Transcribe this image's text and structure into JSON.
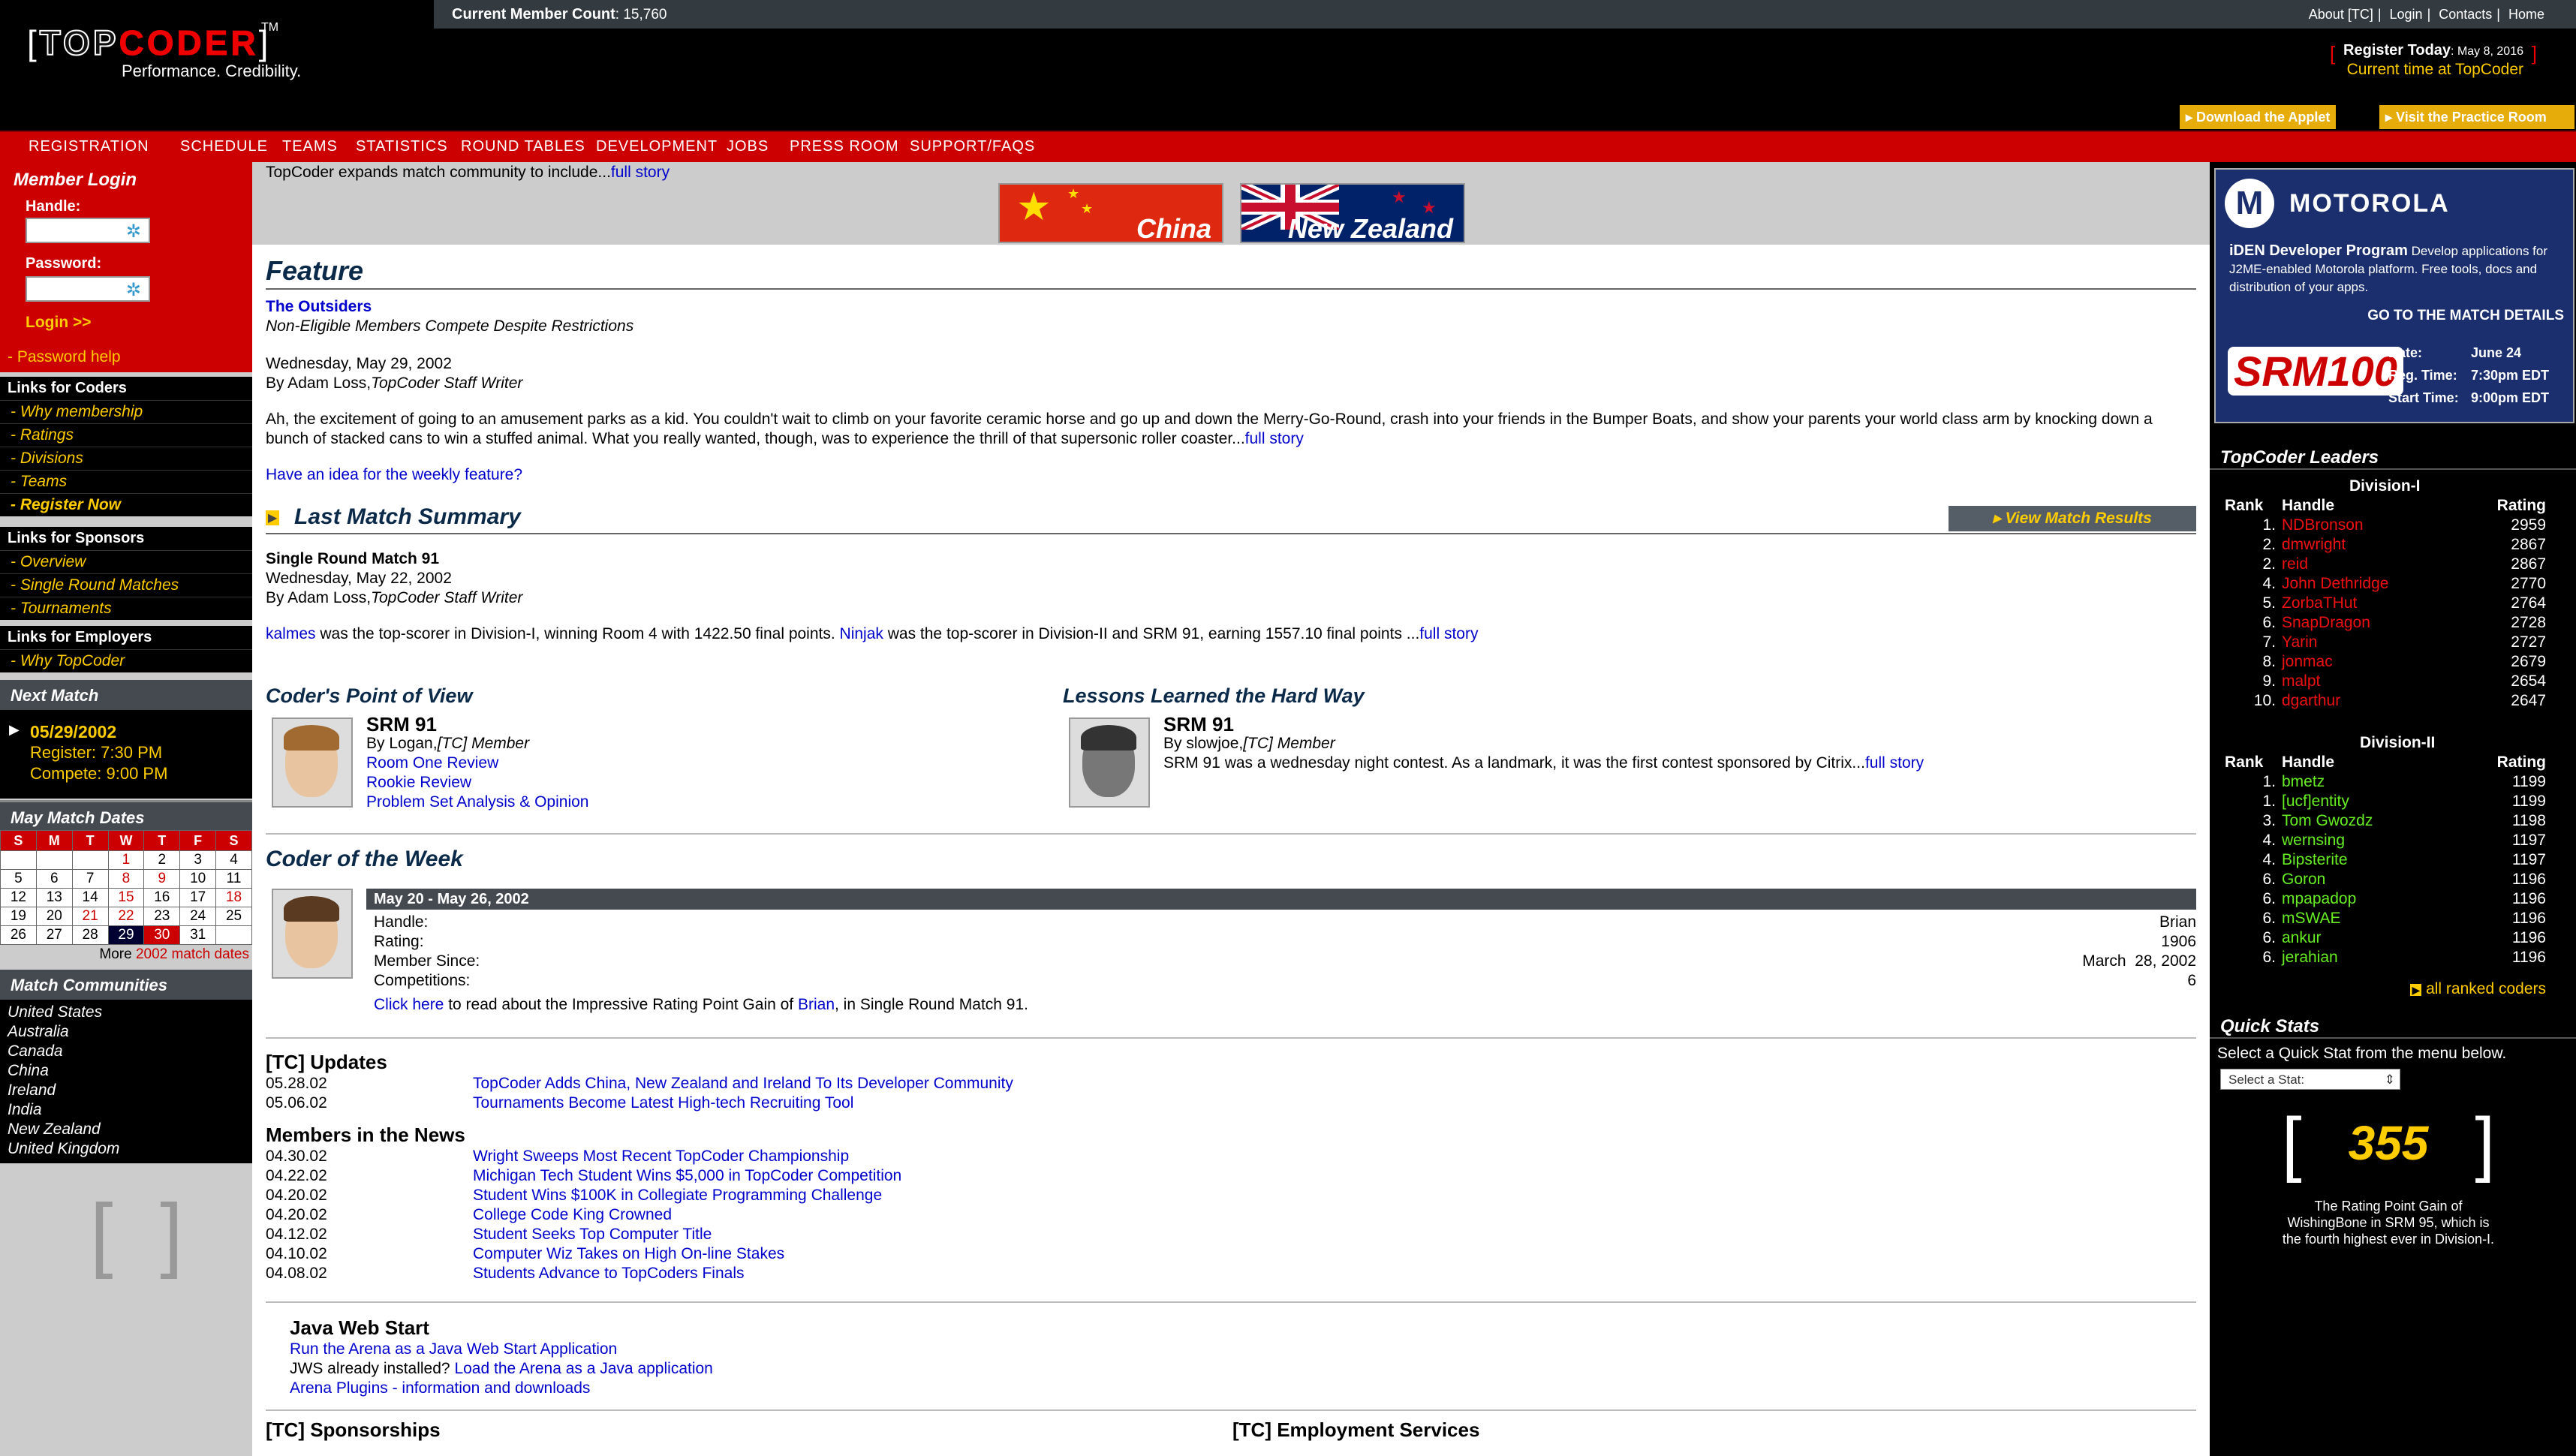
{
  "header": {
    "member_count_label": "Current Member Count",
    "member_count": ": 15,760",
    "top_links": [
      "About [TC]",
      "Login",
      "Contacts",
      "Home"
    ],
    "logo_text": "TOPCODER",
    "logo_tm": "TM",
    "tagline": "Performance. Credibility.",
    "register_label": "Register Today",
    "register_date": ": May 8, 2016",
    "current_time_label": "Current time at TopCoder",
    "applet_buttons": [
      "Download the Applet",
      "Visit the Practice Room"
    ]
  },
  "nav": [
    "REGISTRATION",
    "SCHEDULE",
    "TEAMS",
    "STATISTICS",
    "ROUND TABLES",
    "DEVELOPMENT",
    "JOBS",
    "PRESS ROOM",
    "SUPPORT/FAQS"
  ],
  "left": {
    "login_title": "Member Login",
    "handle_label": "Handle:",
    "password_label": "Password:",
    "login_button": "Login >>",
    "password_help": "- Password help",
    "coders_title": "Links for Coders",
    "coders_links": [
      "- Why membership",
      "- Ratings",
      "- Divisions",
      "- Teams",
      "- Register Now"
    ],
    "sponsors_title": "Links for Sponsors",
    "sponsors_links": [
      "- Overview",
      "- Single Round Matches",
      "- Tournaments"
    ],
    "employers_title": "Links for Employers",
    "employers_links": [
      "- Why TopCoder"
    ],
    "next_match_title": "Next Match",
    "next_match_date": "05/29/2002",
    "next_match_register": "Register:  7:30 PM",
    "next_match_compete": "Compete:  9:00 PM",
    "calendar_title": "May Match Dates",
    "calendar_days": [
      "S",
      "M",
      "T",
      "W",
      "T",
      "F",
      "S"
    ],
    "calendar_more_prefix": "More ",
    "calendar_more_link": "2002 match dates",
    "communities_title": "Match Communities",
    "communities": [
      "United States",
      "Australia",
      "Canada",
      "China",
      "Ireland",
      "India",
      "New Zealand",
      "United Kingdom"
    ],
    "bracket_glyph": "[ ]"
  },
  "center": {
    "expand_text": "TopCoder expands match community to include...",
    "expand_link": "full story",
    "flags": [
      "China",
      "New Zealand"
    ],
    "feature_title": "Feature",
    "feature_link": "The Outsiders",
    "feature_sub": "Non-Eligible Members Compete Despite Restrictions",
    "feature_date": "Wednesday, May 29, 2002",
    "feature_by": "By Adam Loss,",
    "feature_by_role": "TopCoder Staff Writer",
    "feature_body": "Ah, the excitement of going to an amusement parks as a kid. You couldn't wait to climb on your favorite ceramic horse and go up and down the Merry-Go-Round, crash into your friends in the Bumper Boats, and show your parents your world class arm by knocking down a bunch of stacked cans to win a stuffed animal. What you really wanted, though, was to experience the thrill of that supersonic roller coaster...",
    "feature_more": "full story",
    "feature_idea": "Have an idea for the weekly feature?",
    "lms_title": "Last Match Summary",
    "lms_button": "View Match Results",
    "lms_match": "Single Round Match 91",
    "lms_date": "Wednesday, May 22, 2002",
    "lms_by": "By Adam Loss,",
    "lms_by_role": "TopCoder Staff Writer",
    "lms_user1": "kalmes",
    "lms_text1": " was the top-scorer in Division-I, winning Room 4 with 1422.50 final points. ",
    "lms_user2": "Ninjak",
    "lms_text2": " was the top-scorer in Division-II and SRM 91, earning 1557.10 final points ...",
    "lms_more": "full story",
    "pov_title": "Coder's Point of View",
    "pov_srm": "SRM 91",
    "pov_by": "By Logan,",
    "pov_role": "[TC] Member",
    "pov_links": [
      "Room One Review",
      "Rookie Review",
      "Problem Set Analysis & Opinion"
    ],
    "lessons_title": "Lessons Learned the Hard Way",
    "lessons_srm": "SRM 91",
    "lessons_by": "By slowjoe,",
    "lessons_role": "[TC] Member",
    "lessons_text": "SRM 91 was a wednesday night contest. As a landmark, it was the first contest sponsored by Citrix...",
    "lessons_more": "full story",
    "cotw_title": "Coder of the Week",
    "cotw_range": "May 20 - May 26, 2002",
    "cotw_labels": [
      "Handle:",
      "Rating:",
      "Member Since:",
      "Competitions:"
    ],
    "cotw_values": [
      "Brian",
      "1906",
      "March  28, 2002",
      "6"
    ],
    "cotw_click": "Click here",
    "cotw_text1": " to read about the Impressive Rating Point Gain of ",
    "cotw_name": "Brian",
    "cotw_text2": ", in Single Round Match 91.",
    "updates_title": "[TC] Updates",
    "updates": [
      {
        "date": "05.28.02",
        "text": "TopCoder Adds China, New Zealand and Ireland To Its Developer Community"
      },
      {
        "date": "05.06.02",
        "text": "Tournaments Become Latest High-tech Recruiting Tool"
      }
    ],
    "news_title": "Members in the News",
    "news": [
      {
        "date": "04.30.02",
        "text": "Wright Sweeps Most Recent TopCoder Championship"
      },
      {
        "date": "04.22.02",
        "text": "Michigan Tech Student Wins $5,000 in TopCoder Competition"
      },
      {
        "date": "04.20.02",
        "text": "Student Wins $100K in Collegiate Programming Challenge"
      },
      {
        "date": "04.20.02",
        "text": "College Code King Crowned"
      },
      {
        "date": "04.12.02",
        "text": "Student Seeks Top Computer Title"
      },
      {
        "date": "04.10.02",
        "text": "Computer Wiz Takes on High On-line Stakes"
      },
      {
        "date": "04.08.02",
        "text": "Students Advance to TopCoders Finals"
      }
    ],
    "jws_title": "Java Web Start",
    "jws_link1": "Run the Arena as a Java Web Start Application",
    "jws_text": "JWS already installed? ",
    "jws_link2": "Load the Arena as a Java application",
    "jws_link3": "Arena Plugins - information and downloads",
    "sponsorships_title": "[TC] Sponsorships",
    "employment_title": "[TC] Employment Services"
  },
  "right": {
    "ad_brand": "MOTOROLA",
    "ad_program": "iDEN Developer Program",
    "ad_desc": " Develop applications for J2ME-enabled Motorola platform. Free tools, docs and distribution of your apps.",
    "ad_go": "GO TO THE MATCH DETAILS",
    "ad_srm": "SRM100",
    "ad_details": [
      {
        "label": "Date:",
        "value": "June 24"
      },
      {
        "label": "Reg. Time:",
        "value": "7:30pm EDT"
      },
      {
        "label": "Start Time:",
        "value": "9:00pm EDT"
      }
    ],
    "leaders_title": "TopCoder Leaders",
    "div1_title": "Division-I",
    "div2_title": "Division-II",
    "col_rank": "Rank",
    "col_handle": "Handle",
    "col_rating": "Rating",
    "div1": [
      {
        "rank": "1.",
        "handle": "NDBronson",
        "rating": "2959"
      },
      {
        "rank": "2.",
        "handle": "dmwright",
        "rating": "2867"
      },
      {
        "rank": "2.",
        "handle": "reid",
        "rating": "2867"
      },
      {
        "rank": "4.",
        "handle": "John Dethridge",
        "rating": "2770"
      },
      {
        "rank": "5.",
        "handle": "ZorbaTHut",
        "rating": "2764"
      },
      {
        "rank": "6.",
        "handle": "SnapDragon",
        "rating": "2728"
      },
      {
        "rank": "7.",
        "handle": "Yarin",
        "rating": "2727"
      },
      {
        "rank": "8.",
        "handle": "jonmac",
        "rating": "2679"
      },
      {
        "rank": "9.",
        "handle": "malpt",
        "rating": "2654"
      },
      {
        "rank": "10.",
        "handle": "dgarthur",
        "rating": "2647"
      }
    ],
    "div2": [
      {
        "rank": "1.",
        "handle": "bmetz",
        "rating": "1199"
      },
      {
        "rank": "1.",
        "handle": "[ucf]entity",
        "rating": "1199"
      },
      {
        "rank": "3.",
        "handle": "Tom Gwozdz",
        "rating": "1198"
      },
      {
        "rank": "4.",
        "handle": "wernsing",
        "rating": "1197"
      },
      {
        "rank": "4.",
        "handle": "Bipsterite",
        "rating": "1197"
      },
      {
        "rank": "6.",
        "handle": "Goron",
        "rating": "1196"
      },
      {
        "rank": "6.",
        "handle": "mpapadop",
        "rating": "1196"
      },
      {
        "rank": "6.",
        "handle": "mSWAE",
        "rating": "1196"
      },
      {
        "rank": "6.",
        "handle": "ankur",
        "rating": "1196"
      },
      {
        "rank": "6.",
        "handle": "jerahian",
        "rating": "1196"
      }
    ],
    "all_ranked": "all ranked coders",
    "quick_stats_title": "Quick Stats",
    "quick_stats_prompt": "Select a Quick Stat from the menu below.",
    "quick_stats_select": "Select a Stat:",
    "stat_number": "355",
    "stat_caption": "The Rating Point Gain of WishingBone in SRM 95, which is the fourth highest ever in Division-I."
  },
  "colors": {
    "red": "#cc0000",
    "yellow": "#ffcc00",
    "navy": "#0b2a4a",
    "link": "#0000cc"
  }
}
